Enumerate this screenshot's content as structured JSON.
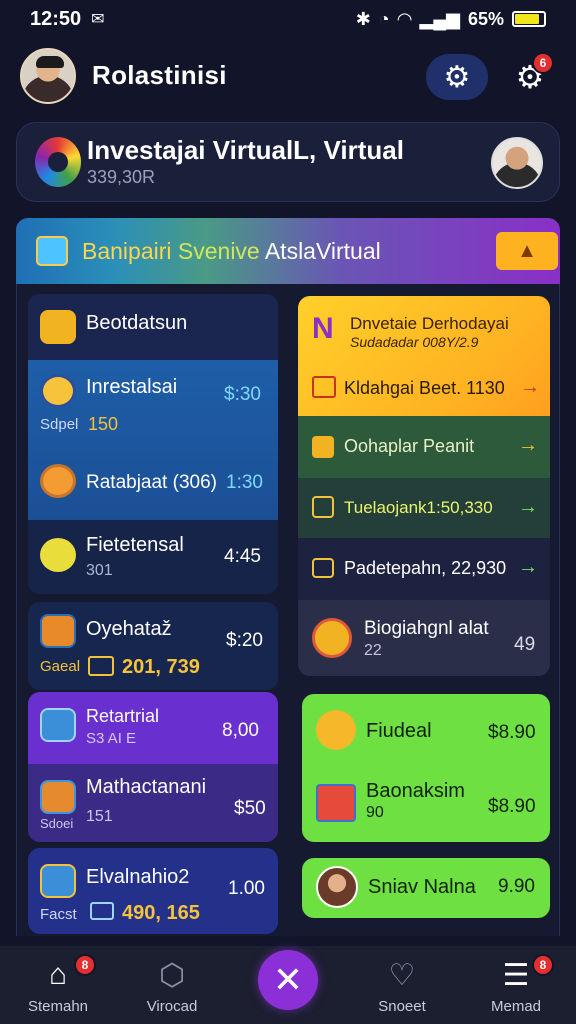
{
  "status": {
    "time": "12:50",
    "battery": "65%",
    "battery_level": 0.85
  },
  "header": {
    "title": "Rolastinisi",
    "badge_count": "6"
  },
  "invest_card": {
    "title": "Investajai VirtualL, Virtual",
    "subtitle": "339,30R"
  },
  "banner": {
    "part1": "Banipairi",
    "part2": "Svenive",
    "part3": "AtslaVirtual",
    "badge": "▲"
  },
  "left": {
    "header_label": "Beotdatsun",
    "items": [
      {
        "label": "Inrestalsai",
        "sub": "Sdpel",
        "sub_value": "150",
        "value": "$:30"
      },
      {
        "label": "Ratabjaat (306)",
        "value": "1:30"
      },
      {
        "label": "Fietetensal",
        "sub": "301",
        "value": "4:45"
      }
    ],
    "card2": {
      "label": "Oyehataž",
      "value": "$:20",
      "sub": "Gaeal",
      "highlight": "201, 739"
    },
    "card3": {
      "items": [
        {
          "label": "Retartrial",
          "sub": "S3 AI E",
          "value": "8,00"
        },
        {
          "label": "Mathactanani",
          "sub": "Sdoei",
          "sub_value": "151",
          "value": "$50"
        }
      ]
    },
    "card4": {
      "label": "Elvalnahio2",
      "value": "1.00",
      "sub": "Facst",
      "highlight": "490, 165"
    }
  },
  "right": {
    "top": {
      "title": "Dnvetaie Derhodayai",
      "subtitle": "Sudadadar 008Y/2.9",
      "row_label": "Kldahgai Beet. 1130"
    },
    "rows": [
      {
        "label": "Oohaplar Peanit"
      },
      {
        "label": "Tuelaojank1:50,330"
      },
      {
        "label": "Padetepahn, 22,930"
      }
    ],
    "info": {
      "label": "Biogiahgnl alat",
      "sub": "22",
      "value": "49"
    },
    "green1": {
      "items": [
        {
          "label": "Fiudeal",
          "value": "$8.90"
        },
        {
          "label": "Baonaksim",
          "sub": "90",
          "value": "$8.90"
        }
      ]
    },
    "green2": {
      "label": "Sniav Nalna",
      "value": "9.90"
    }
  },
  "nav": {
    "items": [
      {
        "label": "Stemahn",
        "badge": "8"
      },
      {
        "label": "Virocad"
      },
      {
        "label": "Snoeet"
      },
      {
        "label": "Memad",
        "badge": "8"
      }
    ]
  },
  "colors": {
    "background": "#12152a",
    "accent_purple": "#8b2fd6",
    "yellow": "#ffd02a",
    "green": "#6fe042"
  }
}
